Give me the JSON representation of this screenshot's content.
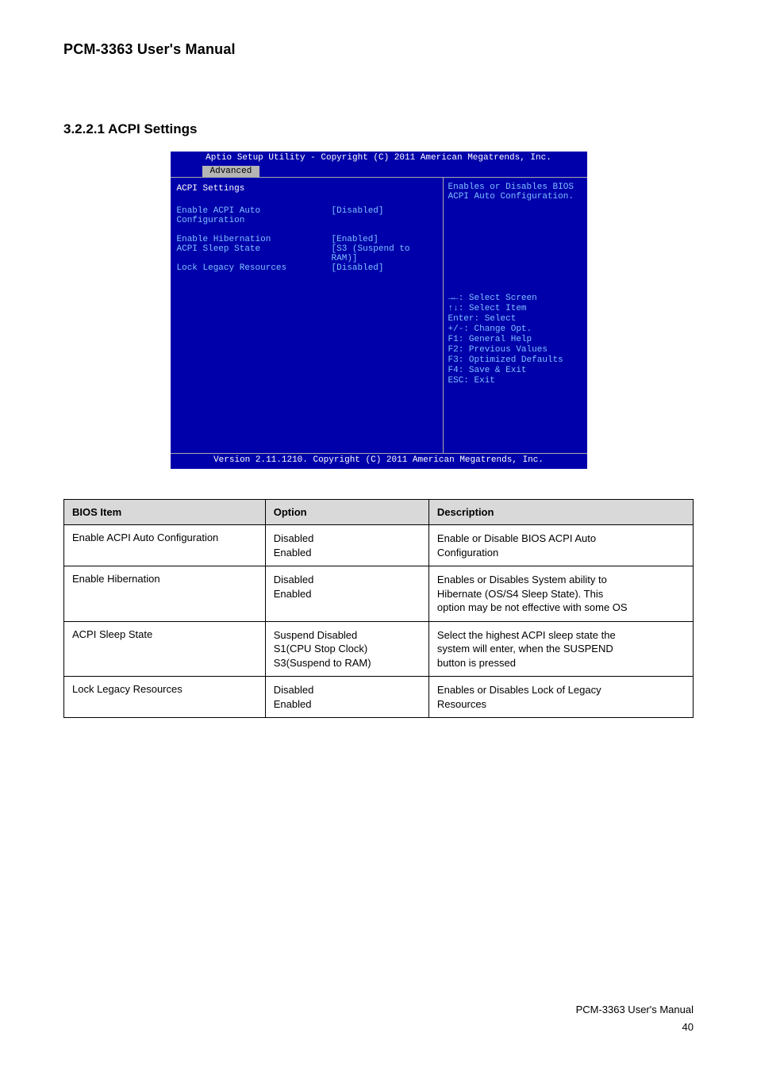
{
  "doc": {
    "manual_title": "PCM-3363 User's Manual",
    "section_title": "3.2.2.1 ACPI Settings",
    "footer_manual": "PCM-3363 User's Manual",
    "footer_page": "40"
  },
  "bios": {
    "title_bar": "Aptio Setup Utility - Copyright (C) 2011 American Megatrends, Inc.",
    "tab": "Advanced",
    "header": "ACPI Settings",
    "rows": [
      {
        "label": "Enable ACPI Auto Configuration",
        "value": "[Disabled]"
      }
    ],
    "rows2": [
      {
        "label": "Enable Hibernation",
        "value": "[Enabled]"
      },
      {
        "label": "ACPI Sleep State",
        "value": "[S3 (Suspend to RAM)]"
      },
      {
        "label": "Lock Legacy Resources",
        "value": "[Disabled]"
      }
    ],
    "help_top": "Enables or Disables BIOS ACPI Auto Configuration.",
    "nav": {
      "l1": "→←: Select Screen",
      "l2": "↑↓: Select Item",
      "l3": "Enter: Select",
      "l4": "+/-: Change Opt.",
      "l5": "F1: General Help",
      "l6": "F2: Previous Values",
      "l7": "F3: Optimized Defaults",
      "l8": "F4: Save & Exit",
      "l9": "ESC: Exit"
    },
    "footer": "Version 2.11.1210. Copyright (C) 2011 American Megatrends, Inc."
  },
  "table": {
    "headers": {
      "item": "BIOS Item",
      "option": "Option",
      "desc": "Description"
    },
    "rows": [
      {
        "item": "Enable ACPI Auto Configuration",
        "option_lines": [
          "Disabled",
          "Enabled"
        ],
        "desc_lines": [
          "Enable or Disable BIOS ACPI Auto",
          "Configuration"
        ]
      },
      {
        "item": "Enable Hibernation",
        "option_lines": [
          "Disabled",
          "Enabled"
        ],
        "desc_lines": [
          "Enables or Disables System ability to",
          "Hibernate (OS/S4 Sleep State). This",
          "option may be not effective with some OS"
        ]
      },
      {
        "item": "ACPI Sleep State",
        "option_lines": [
          "Suspend Disabled",
          "S1(CPU Stop Clock)",
          "S3(Suspend to RAM)"
        ],
        "desc_lines": [
          "Select the highest ACPI sleep state the",
          "system will enter, when the SUSPEND",
          "button is pressed"
        ]
      },
      {
        "item": "Lock Legacy Resources",
        "option_lines": [
          "Disabled",
          "Enabled"
        ],
        "desc_lines": [
          "Enables or Disables Lock of Legacy",
          "Resources"
        ]
      }
    ]
  }
}
